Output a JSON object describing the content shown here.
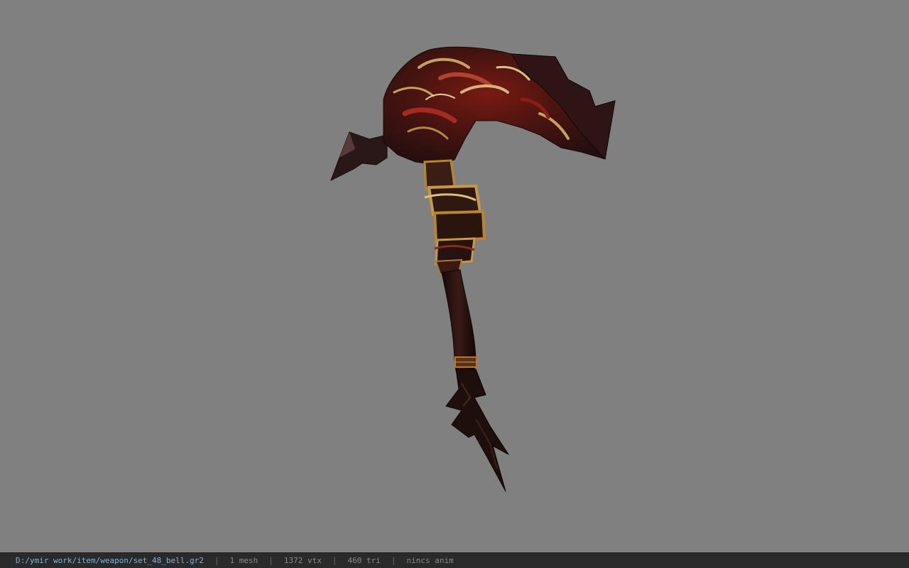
{
  "viewport": {
    "background": "#808080",
    "model": "scythe-weapon-model"
  },
  "status_bar": {
    "file_path": "D:/ymir work/item/weapon/set_48_bell.gr2",
    "separator": "|",
    "mesh_count": "1 mesh",
    "vertex_count": "1372 vtx",
    "triangle_count": "460 tri",
    "anim_status": "nincs anim"
  },
  "colors": {
    "status_bg": "#2a2a2a",
    "path_text": "#7fb2dc",
    "stat_text": "#8a8a8a"
  }
}
